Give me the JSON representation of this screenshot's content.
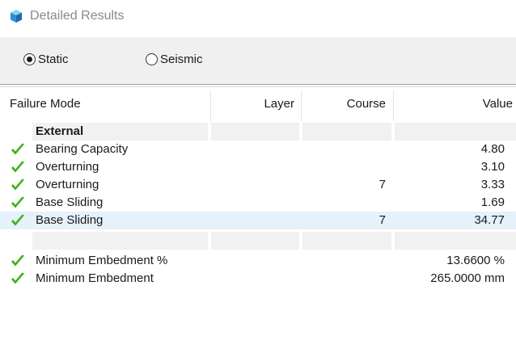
{
  "window": {
    "title": "Detailed Results",
    "icon": "cube-icon"
  },
  "analysis_mode": {
    "options": [
      {
        "label": "Static",
        "selected": true
      },
      {
        "label": "Seismic",
        "selected": false
      }
    ]
  },
  "table": {
    "columns": [
      "Failure Mode",
      "Layer",
      "Course",
      "Value"
    ],
    "group": "External",
    "rows": [
      {
        "name": "Bearing Capacity",
        "layer": "",
        "course": "",
        "value": "4.80",
        "status": "pass"
      },
      {
        "name": "Overturning",
        "layer": "",
        "course": "",
        "value": "3.10",
        "status": "pass"
      },
      {
        "name": "Overturning",
        "layer": "",
        "course": "7",
        "value": "3.33",
        "status": "pass"
      },
      {
        "name": "Base Sliding",
        "layer": "",
        "course": "",
        "value": "1.69",
        "status": "pass"
      },
      {
        "name": "Base Sliding",
        "layer": "",
        "course": "7",
        "value": "34.77",
        "status": "pass",
        "selected": true
      }
    ],
    "summary_rows": [
      {
        "name": "Minimum Embedment %",
        "value": "13.6600 %",
        "status": "pass"
      },
      {
        "name": "Minimum Embedment",
        "value": "265.0000 mm",
        "status": "pass"
      }
    ]
  },
  "colors": {
    "check": "#3bb31c",
    "selected_row": "#e5f1fb",
    "group_fill": "#f1f1f1",
    "toolbar": "#f0f0f0"
  }
}
